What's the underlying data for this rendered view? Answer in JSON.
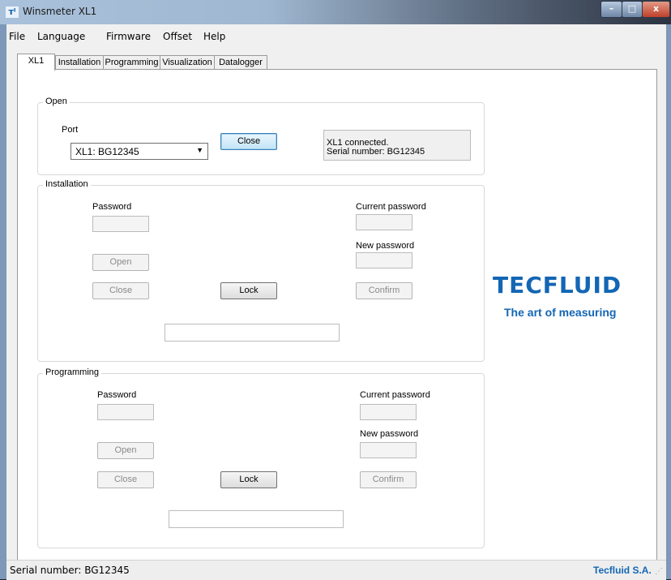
{
  "window": {
    "title": "Winsmeter XL1",
    "icon": "tecfluid-app-icon"
  },
  "titlebar_buttons": {
    "minimize": "–",
    "maximize": "□",
    "close": "x"
  },
  "menu": [
    "File",
    "Language",
    "Firmware",
    "Offset",
    "Help"
  ],
  "tabs": [
    {
      "label": "XL1",
      "active": true
    },
    {
      "label": "Installation",
      "active": false
    },
    {
      "label": "Programming",
      "active": false
    },
    {
      "label": "Visualization",
      "active": false
    },
    {
      "label": "Datalogger",
      "active": false
    }
  ],
  "open_group": {
    "title": "Open",
    "port_label": "Port",
    "port_value": "XL1:   BG12345",
    "close_button": "Close",
    "status_line1": "XL1 connected.",
    "status_line2": "Serial number: BG12345"
  },
  "installation_group": {
    "title": "Installation",
    "password_label": "Password",
    "current_password_label": "Current password",
    "new_password_label": "New password",
    "open_button": "Open",
    "close_button": "Close",
    "lock_button": "Lock",
    "confirm_button": "Confirm",
    "status_text": ""
  },
  "programming_group": {
    "title": "Programming",
    "password_label": "Password",
    "current_password_label": "Current password",
    "new_password_label": "New password",
    "open_button": "Open",
    "close_button": "Close",
    "lock_button": "Lock",
    "confirm_button": "Confirm",
    "status_text": ""
  },
  "logo": {
    "brand": "TECFLUID",
    "tagline": "The art of measuring",
    "color": "#1366b4"
  },
  "statusbar": {
    "left": "Serial number: BG12345",
    "right": "Tecfluid S.A."
  }
}
